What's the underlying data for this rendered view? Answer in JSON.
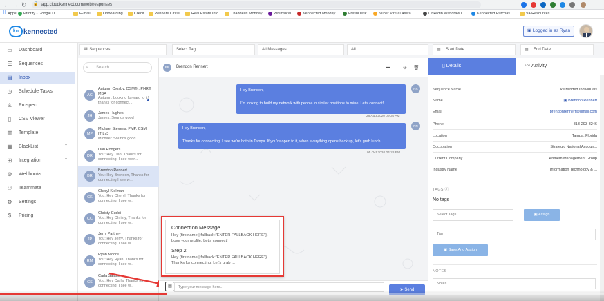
{
  "browser": {
    "url": "app.cloudkennect.com/web/responses",
    "apps_label": "Apps",
    "bookmarks": [
      "Priority - Google D...",
      "E-mail",
      "Onboarding",
      "Credit",
      "Winners Circle",
      "Real Estate Info",
      "Thaddeus Monday",
      "Whimsical",
      "Kennected Monday",
      "FreshDesk",
      "Super Virtual Assta...",
      "LinkedIn Withdraw L...",
      "Kennected Purchas...",
      "VA Resources"
    ]
  },
  "header": {
    "logo_mark": "kn",
    "logo_text": "kennected",
    "login_label": "Logged in as Ryan"
  },
  "sidebar": {
    "items": [
      {
        "label": "Dashboard"
      },
      {
        "label": "Sequences"
      },
      {
        "label": "Inbox"
      },
      {
        "label": "Schedule Tasks"
      },
      {
        "label": "Prospect"
      },
      {
        "label": "CSV Viewer"
      },
      {
        "label": "Template"
      },
      {
        "label": "BlackList"
      },
      {
        "label": "Integration"
      },
      {
        "label": "Webhooks"
      },
      {
        "label": "Teammate"
      },
      {
        "label": "Settings"
      },
      {
        "label": "Pricing"
      }
    ]
  },
  "filters": {
    "sequences": "All Sequences",
    "tag": "Select Tag",
    "messages": "All Messages",
    "all": "All",
    "start_date": "Start Date",
    "end_date": "End Date"
  },
  "search": {
    "placeholder": "Search"
  },
  "conversations": [
    {
      "initials": "AC",
      "name": "Autumn Crosby, CSM® , PHR® , MBA",
      "preview": "Autumn: Looking forward to it! thanks for connect..."
    },
    {
      "initials": "JH",
      "name": "James Hughes",
      "preview": "James: Sounds good"
    },
    {
      "initials": "MP",
      "name": "Michael Stevens, PMP, CSM, ITILv3",
      "preview": "Michael: Sounds good"
    },
    {
      "initials": "DR",
      "name": "Dan Rodgers",
      "preview": "You: Hey Dan, Thanks for connecting. I see we'r..."
    },
    {
      "initials": "BR",
      "name": "Brendon Rennert",
      "preview": "You: Hey Brendon, Thanks for connecting I see w..."
    },
    {
      "initials": "CK",
      "name": "Cheryl Kielman",
      "preview": "You: Hey Cheryl, Thanks for connecting. I see w..."
    },
    {
      "initials": "CC",
      "name": "Christy Cuddi",
      "preview": "You: Hey Christy, Thanks for connecting. I see w..."
    },
    {
      "initials": "JP",
      "name": "Jerry Partney",
      "preview": "You: Hey Jerry, Thanks for connecting. I see w..."
    },
    {
      "initials": "RM",
      "name": "Ryan Moore",
      "preview": "You: Hey Ryan, Thanks for connecting. I see w..."
    },
    {
      "initials": "CS",
      "name": "Carla Salano",
      "preview": "You: Hey Carla, Thanks for connecting. I see w..."
    }
  ],
  "chat": {
    "contact_initials": "BR",
    "contact_name": "Brendon Rennert",
    "messages": [
      {
        "initials": "RR",
        "greeting": "Hey Brendon,",
        "body": "I'm looking to build my network with people in similar positions to mine. Let's connect!",
        "time": "26 Aug 2020 09:30 AM"
      },
      {
        "initials": "RR",
        "greeting": "Hey Brendon,",
        "body": "Thanks for connecting. I see we're both in Tampa. If you're open to it, when everything opens back up, let's grab lunch.",
        "time": "05 Oct 2020 04:28 PM"
      }
    ],
    "popup": {
      "title1": "Connection Message",
      "body1": "Hey {firstname | fallback:\"ENTER FALLBACK HERE\"}. Love your profile. Let's connect!",
      "title2": "Step 2",
      "body2": "Hey {firstname | fallback:\"ENTER FALLBACK HERE\"}. Thanks for connecting. Let's grab ..."
    },
    "input_placeholder": "Type your message here...",
    "send_label": "Send"
  },
  "details": {
    "tab_details": "Details",
    "tab_activity": "Activity",
    "rows": [
      {
        "k": "Sequence Name",
        "v": "Like Minded Individuals"
      },
      {
        "k": "Name",
        "v": "Brendon Rennert"
      },
      {
        "k": "Email",
        "v": "brendonrennert@gmail.com"
      },
      {
        "k": "Phone",
        "v": "813-293-3246"
      },
      {
        "k": "Location",
        "v": "Tampa, Florida"
      },
      {
        "k": "Occupation",
        "v": "Strategic National Accoun..."
      },
      {
        "k": "Current Company",
        "v": "Anthem Management Group"
      },
      {
        "k": "Industry Name",
        "v": "Information Technology & ..."
      }
    ],
    "tags_label": "TAGS",
    "no_tags": "No tags",
    "select_tags": "Select Tags",
    "assign": "Assign",
    "tag_placeholder": "Tag",
    "save_assign": "Save And Assign",
    "notes_label": "NOTES",
    "notes_placeholder": "Notes"
  }
}
